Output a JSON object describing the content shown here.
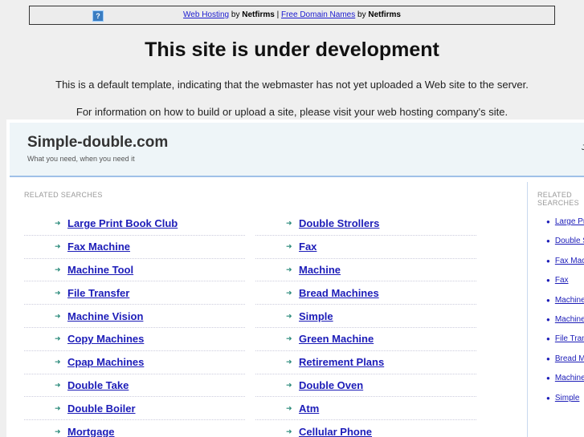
{
  "topbar": {
    "help_icon": "?",
    "link1": "Web Hosting",
    "by1": " by ",
    "brand1": "Netfirms",
    "sep": " | ",
    "link2": "Free Domain Names",
    "by2": " by ",
    "brand2": "Netfirms"
  },
  "title": "This site is under development",
  "line1": "This is a default template, indicating that the webmaster has not yet uploaded a Web site to the server.",
  "line2": "For information on how to build or upload a site, please visit your web hosting company's site.",
  "site": {
    "name": "Simple-double.com",
    "tagline": "What you need, when you need it",
    "date": "Ju"
  },
  "related_label": "RELATED SEARCHES",
  "left_col": [
    "Large Print Book Club",
    "Fax Machine",
    "Machine Tool",
    "File Transfer",
    "Machine Vision",
    "Copy Machines",
    "Cpap Machines",
    "Double Take",
    "Double Boiler",
    "Mortgage"
  ],
  "right_col": [
    "Double Strollers",
    "Fax",
    "Machine",
    "Bread Machines",
    "Simple",
    "Green Machine",
    "Retirement Plans",
    "Double Oven",
    "Atm",
    "Cellular Phone"
  ],
  "side_label": "RELATED SEARCHES",
  "side": [
    "Large Print Book Club",
    "Double Strollers",
    "Fax Machine",
    "Fax",
    "Machine Tool",
    "Machine",
    "File Transfer",
    "Bread Machines",
    "Machine Vision",
    "Simple"
  ]
}
